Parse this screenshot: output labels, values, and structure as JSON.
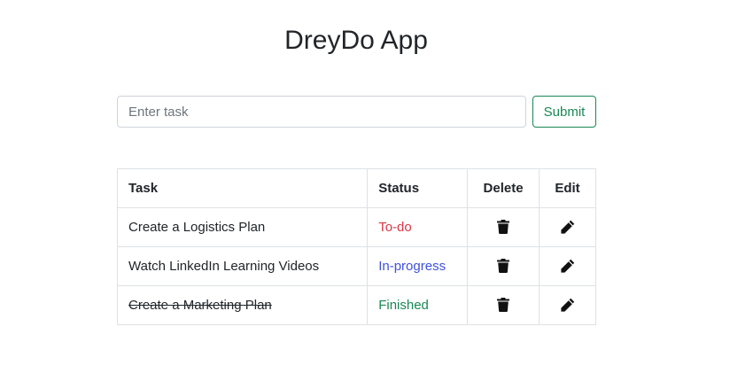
{
  "app": {
    "title": "DreyDo App"
  },
  "form": {
    "input_value": "",
    "input_placeholder": "Enter task",
    "submit_label": "Submit"
  },
  "table": {
    "headers": {
      "task": "Task",
      "status": "Status",
      "delete": "Delete",
      "edit": "Edit"
    },
    "rows": [
      {
        "task": "Create a Logistics Plan",
        "status": "To-do",
        "finished": false,
        "delete_icon": "trash-icon",
        "edit_icon": "pencil-icon"
      },
      {
        "task": "Watch LinkedIn Learning Videos",
        "status": "In-progress",
        "finished": false,
        "delete_icon": "trash-icon",
        "edit_icon": "pencil-icon"
      },
      {
        "task": "Create a Marketing Plan",
        "status": "Finished",
        "finished": true,
        "delete_icon": "trash-icon",
        "edit_icon": "pencil-icon"
      }
    ]
  },
  "colors": {
    "todo": "#dc3545",
    "in_progress": "#3f51e0",
    "finished": "#198754",
    "submit": "#198754",
    "border": "#dee2e6"
  }
}
